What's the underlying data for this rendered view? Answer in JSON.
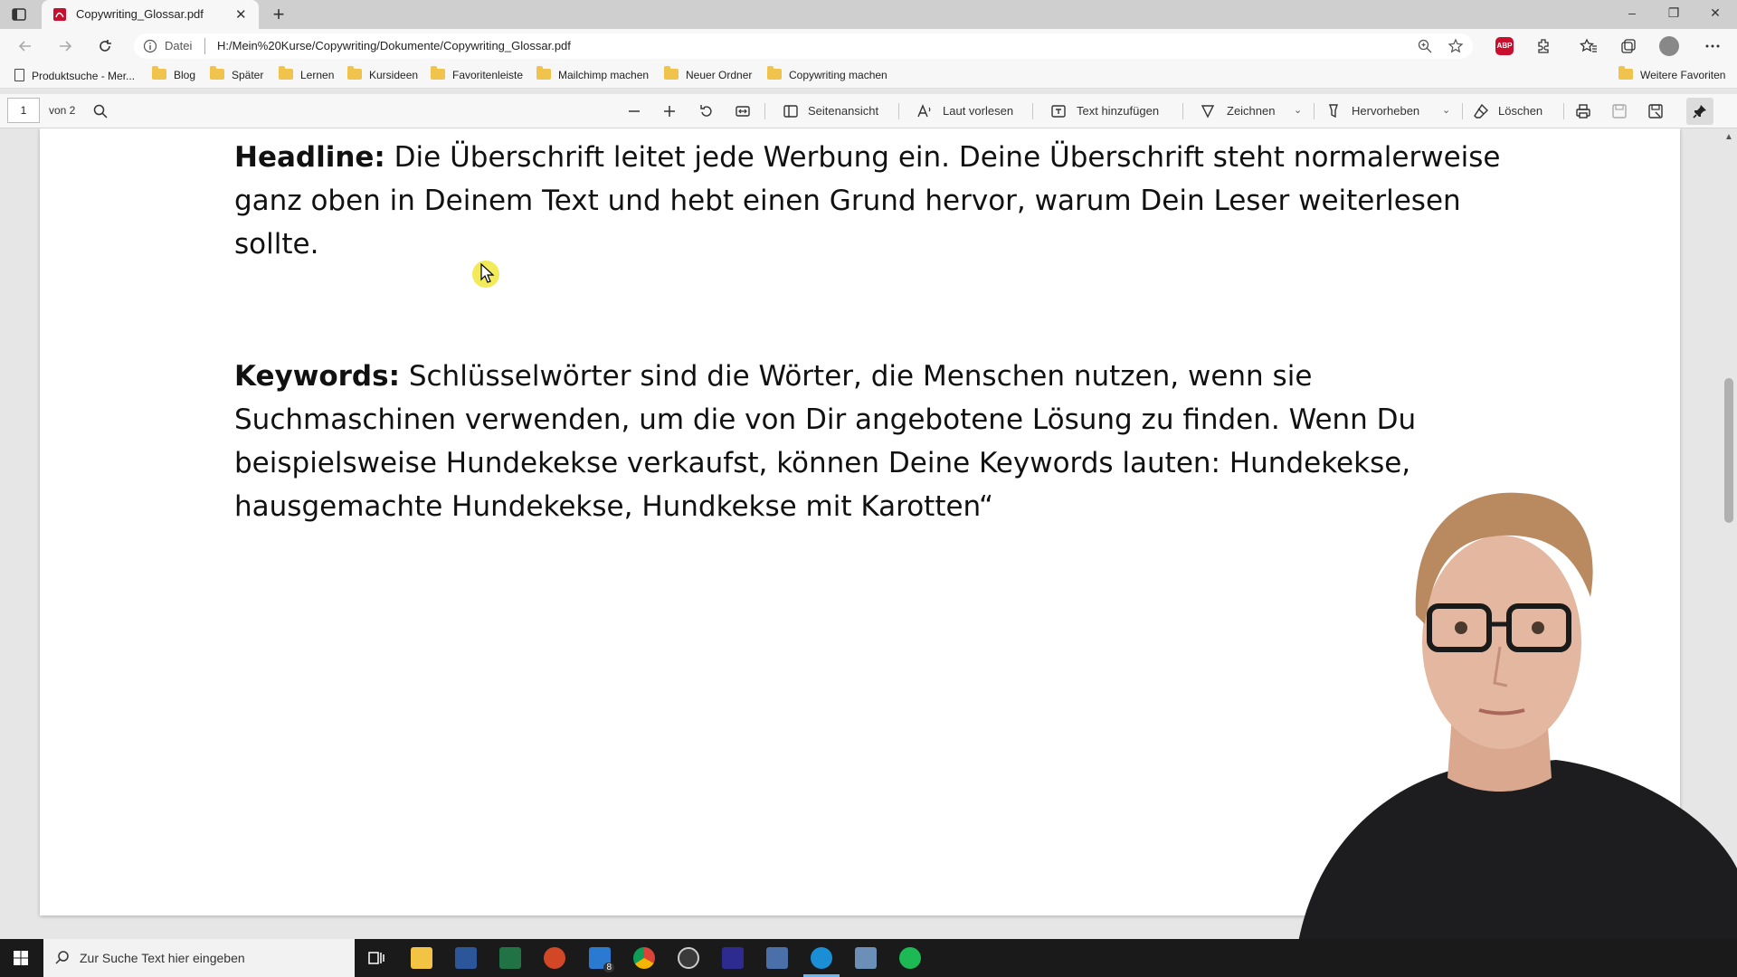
{
  "browser": {
    "tab_title": "Copywriting_Glossar.pdf",
    "address_label": "Datei",
    "url": "H:/Mein%20Kurse/Copywriting/Dokumente/Copywriting_Glossar.pdf",
    "adblock_label": "ABP"
  },
  "bookmarks": {
    "items": [
      "Produktsuche - Mer...",
      "Blog",
      "Später",
      "Lernen",
      "Kursideen",
      "Favoritenleiste",
      "Mailchimp machen",
      "Neuer Ordner",
      "Copywriting machen"
    ],
    "more": "Weitere Favoriten"
  },
  "pdf_toolbar": {
    "page_number": "1",
    "page_of": "von 2",
    "seitenansicht": "Seitenansicht",
    "laut_vorlesen": "Laut vorlesen",
    "text_hinzufuegen": "Text hinzufügen",
    "zeichnen": "Zeichnen",
    "hervorheben": "Hervorheben",
    "loeschen": "Löschen"
  },
  "document": {
    "headline_term": "Headline:",
    "headline_text": " Die Überschrift leitet jede Werbung ein. Deine Überschrift steht normalerweise ganz oben in Deinem Text und hebt einen Grund hervor, warum Dein Leser weiterlesen sollte.",
    "keywords_term": "Keywords:",
    "keywords_text": " Schlüsselwörter sind die Wörter, die Menschen nutzen, wenn sie Suchmaschinen verwenden, um die von Dir angebotene Lösung zu finden. Wenn Du beispielsweise Hundekekse verkaufst, können Deine Keywords lauten: Hundekekse, hausgemachte Hundekekse, Hundkekse mit Karotten“"
  },
  "taskbar": {
    "search_placeholder": "Zur Suche Text hier eingeben",
    "mail_badge": "8"
  },
  "colors": {
    "pdf_red": "#c8102e",
    "folder_yellow": "#f0c44c",
    "taskbar": "#1a1a1a",
    "cursor_highlight": "#f0e63c"
  }
}
